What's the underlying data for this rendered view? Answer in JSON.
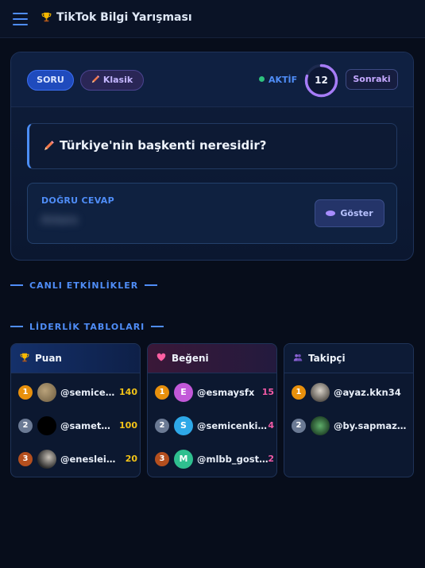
{
  "header": {
    "title": "TikTok Bilgi Yarışması"
  },
  "question_card": {
    "badge": "SORU",
    "category": "Klasik",
    "status": "AKTİF",
    "timer": "12",
    "timer_progress": 0.8,
    "next_label": "Sonraki",
    "question": "Türkiye'nin başkenti neresidir?",
    "answer_label": "DOĞRU CEVAP",
    "answer_value": "Ankara",
    "show_label": "Göster"
  },
  "sections": {
    "live": "CANLI ETKİNLİKLER",
    "leaderboards": "LİDERLİK TABLOLARI"
  },
  "leaderboards": [
    {
      "title": "Puan",
      "icon": "trophy-icon",
      "rows": [
        {
          "rank": "1",
          "user": "@semicenkirpi",
          "value": "140",
          "avatar": ""
        },
        {
          "rank": "2",
          "user": "@sametesiee",
          "value": "100",
          "avatar": ""
        },
        {
          "rank": "3",
          "user": "@enesleicikl",
          "value": "20",
          "avatar": ""
        }
      ]
    },
    {
      "title": "Beğeni",
      "icon": "heart-icon",
      "rows": [
        {
          "rank": "1",
          "user": "@esmaysfx",
          "value": "15",
          "avatar": "E"
        },
        {
          "rank": "2",
          "user": "@semicenkirpi",
          "value": "4",
          "avatar": "S"
        },
        {
          "rank": "3",
          "user": "@mlbb_gostermelik",
          "value": "2",
          "avatar": "M"
        }
      ]
    },
    {
      "title": "Takipçi",
      "icon": "people-icon",
      "rows": [
        {
          "rank": "1",
          "user": "@ayaz.kkn34",
          "value": "",
          "avatar": ""
        },
        {
          "rank": "2",
          "user": "@by.sapmaz.official",
          "value": "",
          "avatar": ""
        }
      ]
    }
  ],
  "colors": {
    "accent": "#4f8df7",
    "gold": "#f3c318",
    "pink": "#f25aa6",
    "purple": "#a88dff",
    "active": "#2ec27e"
  }
}
